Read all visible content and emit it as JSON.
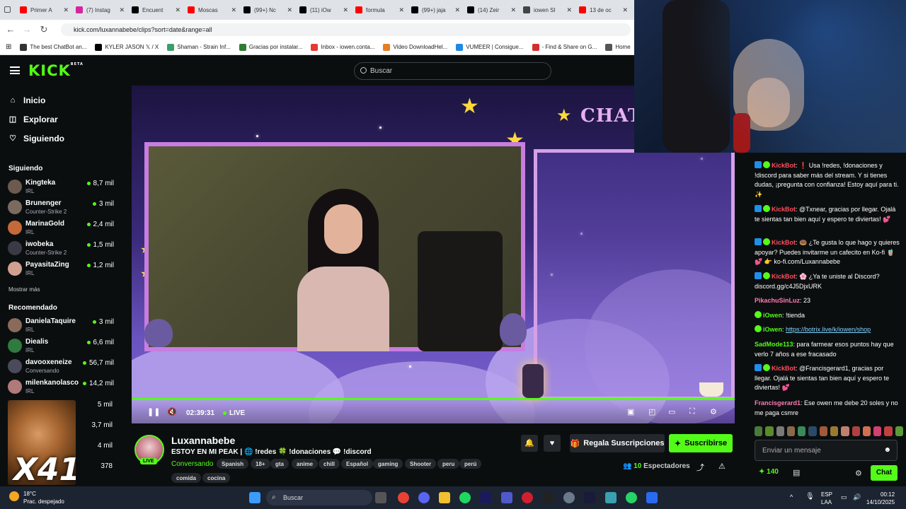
{
  "browser": {
    "tabs": [
      {
        "label": "Primer A",
        "color": "#ff0000"
      },
      {
        "label": "(7) Instag",
        "color": "#d6249f"
      },
      {
        "label": "Encuent",
        "color": "#000000"
      },
      {
        "label": "Moscas",
        "color": "#ff0000"
      },
      {
        "label": "(99+) Nc",
        "color": "#000000"
      },
      {
        "label": "(11) iOw",
        "color": "#000000"
      },
      {
        "label": "formula",
        "color": "#ff0000"
      },
      {
        "label": "(99+) jaja",
        "color": "#000000"
      },
      {
        "label": "(14) Zeir",
        "color": "#000000"
      },
      {
        "label": "iowen SI",
        "color": "#444444"
      },
      {
        "label": "13 de oc",
        "color": "#ff0000"
      }
    ],
    "url": "kick.com/luxannabebe/clips?sort=date&range=all",
    "bookmarks": [
      {
        "label": "The best ChatBot an...",
        "color": "#333333"
      },
      {
        "label": "KYLER JASON 𝕏 / X",
        "color": "#000000"
      },
      {
        "label": "Shaman - Strain Inf...",
        "color": "#3a9f6a"
      },
      {
        "label": "Gracias por instalar...",
        "color": "#2e7d32"
      },
      {
        "label": "Inbox - iowen.conta...",
        "color": "#e53935"
      },
      {
        "label": "Video DownloadHel...",
        "color": "#e67e22"
      },
      {
        "label": "VUMEER | Consigue...",
        "color": "#1e88e5"
      },
      {
        "label": "- Find & Share on G...",
        "color": "#d32f2f"
      },
      {
        "label": "Home",
        "color": "#555555"
      }
    ]
  },
  "header": {
    "logo": "KICK",
    "logo_sup": "BETA",
    "search_placeholder": "Buscar"
  },
  "sidebar": {
    "nav": [
      {
        "label": "Inicio",
        "icon": "⌂"
      },
      {
        "label": "Explorar",
        "icon": "◫"
      },
      {
        "label": "Siguiendo",
        "icon": "♡"
      }
    ],
    "following_title": "Siguiendo",
    "following": [
      {
        "name": "Kingteka",
        "category": "IRL",
        "viewers": "8,7 mil",
        "color": "#6d5a4e"
      },
      {
        "name": "Brunenger",
        "category": "Counter-Strike 2",
        "viewers": "3 mil",
        "color": "#7a6a60"
      },
      {
        "name": "MarinaGold",
        "category": "IRL",
        "viewers": "2,4 mil",
        "color": "#c46a3a"
      },
      {
        "name": "iwobeka",
        "category": "Counter-Strike 2",
        "viewers": "1,5 mil",
        "color": "#3a3a46"
      },
      {
        "name": "PayasitaZing",
        "category": "IRL",
        "viewers": "1,2 mil",
        "color": "#d0a090"
      }
    ],
    "show_more": "Mostrar más",
    "recommended_title": "Recomendado",
    "recommended": [
      {
        "name": "DanielaTaquire",
        "category": "IRL",
        "viewers": "3 mil",
        "color": "#8a6a5a"
      },
      {
        "name": "Diealis",
        "category": "IRL",
        "viewers": "6,6 mil",
        "color": "#2f7a3e"
      },
      {
        "name": "davooxeneize",
        "category": "Conversando",
        "viewers": "56,7 mil",
        "color": "#4a4a5a"
      },
      {
        "name": "milenkanolasco",
        "category": "IRL",
        "viewers": "14,2 mil",
        "color": "#b07a7a"
      }
    ],
    "extra_viewers": [
      "5 mil",
      "3,7 mil",
      "4 mil",
      "378"
    ],
    "overlay_text": "X41"
  },
  "player": {
    "time": "02:39:31",
    "live": "LIVE",
    "overlay_title": "CHAT"
  },
  "channel": {
    "name": "Luxannabebe",
    "live_badge": "LIVE",
    "title": "ESTOY EN MI PEAK | 🌐 !redes 🍀 !donaciones 💬 !discord",
    "category": "Conversando",
    "tags": [
      "Spanish",
      "18+",
      "gta",
      "anime",
      "chill",
      "Español",
      "gaming",
      "Shooter",
      "peru",
      "perú",
      "comida",
      "cocina"
    ],
    "gift_label": "Regala Suscripciones",
    "subscribe_label": "Suscribirse",
    "viewers_count": "10",
    "viewers_label": "Espectadores"
  },
  "chat": {
    "messages": [
      {
        "user": "KickBot",
        "color": "#ff4d5e",
        "badges": [
          "blue",
          "green"
        ],
        "text": ": ❗ Usa !redes, !donaciones y !discord para saber más del stream. Y si tienes dudas, ¡pregunta con confianza! Estoy aquí para ti. ✨"
      },
      {
        "user": "KickBot",
        "color": "#ff4d5e",
        "badges": [
          "blue",
          "green"
        ],
        "text": ": @Txnear, gracias por llegar. Ojalá te sientas tan bien aquí y espero te diviertas! 💕"
      },
      {
        "user": "KickBot",
        "color": "#ff4d5e",
        "badges": [
          "blue",
          "green"
        ],
        "text": ": 🍩 ¿Te gusta lo que hago y quieres apoyar? Puedes invitarme un cafecito en Ko-fi 🧋💕 👉 ko-fi.com/Luxannabebe"
      },
      {
        "user": "KickBot",
        "color": "#ff4d5e",
        "badges": [
          "blue",
          "green"
        ],
        "text": ": 🌸 ¿Ya te uniste al Discord? discord.gg/c4J5DjxURK"
      },
      {
        "user": "PikachuSinLuz",
        "color": "#ff7ab6",
        "badges": [],
        "text": ": 23"
      },
      {
        "user": "iOwen",
        "color": "#53fc18",
        "badges": [
          "green"
        ],
        "text": ": !tienda"
      },
      {
        "user": "iOwen",
        "color": "#53fc18",
        "badges": [
          "green"
        ],
        "text": ": ",
        "link": "https://botrix.live/k/iowen/shop"
      },
      {
        "user": "SadMode113",
        "color": "#53fc18",
        "badges": [],
        "text": ": para farmear esos puntos hay que verlo 7 años a ese fracasado"
      },
      {
        "user": "KickBot",
        "color": "#ff4d5e",
        "badges": [
          "blue",
          "green"
        ],
        "text": ": @Francisgerard1, gracias por llegar. Ojalá te sientas tan bien aquí y espero te diviertas! 💕"
      },
      {
        "user": "Francisgerard1",
        "color": "#ff7ab6",
        "badges": [],
        "text": ": Ese owen me debe 20 soles y no me paga csmre"
      }
    ],
    "input_placeholder": "Enviar un mensaje",
    "points": "140",
    "send_label": "Chat"
  },
  "taskbar": {
    "temperature": "18°C",
    "weather": "Prac. despejado",
    "search": "Buscar",
    "lang1": "ESP",
    "lang2": "LAA",
    "time": "00:12",
    "date": "14/10/2025"
  }
}
